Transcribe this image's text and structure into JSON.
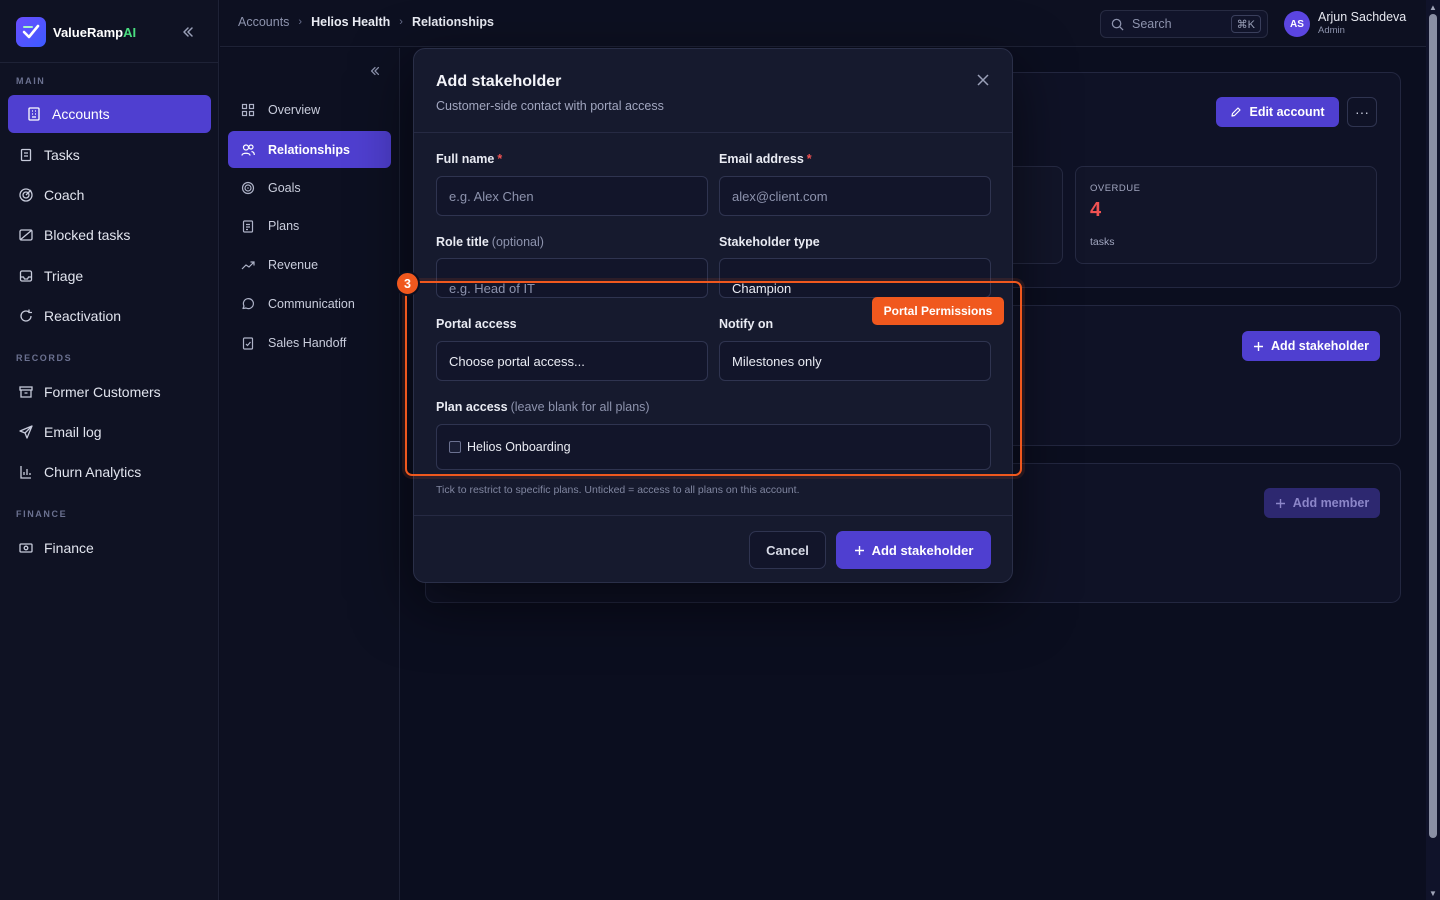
{
  "brand": {
    "name_main": "ValueRamp",
    "name_accent": "AI"
  },
  "sidebar": {
    "sections": {
      "main": "MAIN",
      "records": "RECORDS",
      "finance": "FINANCE"
    },
    "items": [
      {
        "label": "Accounts",
        "icon": "building-icon"
      },
      {
        "label": "Tasks",
        "icon": "clipboard-icon"
      },
      {
        "label": "Coach",
        "icon": "target-icon"
      },
      {
        "label": "Blocked tasks",
        "icon": "blocked-icon"
      },
      {
        "label": "Triage",
        "icon": "inbox-icon"
      },
      {
        "label": "Reactivation",
        "icon": "refresh-icon"
      },
      {
        "label": "Former Customers",
        "icon": "archive-icon"
      },
      {
        "label": "Email log",
        "icon": "send-icon"
      },
      {
        "label": "Churn Analytics",
        "icon": "chart-icon"
      },
      {
        "label": "Finance",
        "icon": "cash-icon"
      }
    ]
  },
  "topbar": {
    "breadcrumbs": [
      "Accounts",
      "Helios Health",
      "Relationships"
    ],
    "search_placeholder": "Search",
    "search_shortcut": "⌘K",
    "user": {
      "initials": "AS",
      "name": "Arjun Sachdeva",
      "role": "Admin"
    }
  },
  "subnav": {
    "items": [
      {
        "label": "Overview",
        "icon": "grid-icon"
      },
      {
        "label": "Relationships",
        "icon": "users-icon"
      },
      {
        "label": "Goals",
        "icon": "target-icon"
      },
      {
        "label": "Plans",
        "icon": "clipboard-icon"
      },
      {
        "label": "Revenue",
        "icon": "trend-icon"
      },
      {
        "label": "Communication",
        "icon": "chat-icon"
      },
      {
        "label": "Sales Handoff",
        "icon": "clipboard-check-icon"
      }
    ]
  },
  "background": {
    "edit_account": "Edit account",
    "overdue_label": "OVERDUE",
    "overdue_value": "4",
    "overdue_unit": "tasks",
    "add_stakeholder": "Add stakeholder",
    "add_member": "Add member"
  },
  "modal": {
    "title": "Add stakeholder",
    "subtitle": "Customer-side contact with portal access",
    "full_name_label": "Full name",
    "full_name_placeholder": "e.g. Alex Chen",
    "email_label": "Email address",
    "email_placeholder": "alex@client.com",
    "role_label": "Role title",
    "role_optional": "(optional)",
    "role_placeholder": "e.g. Head of IT",
    "type_label": "Stakeholder type",
    "type_value": "Champion",
    "portal_label": "Portal access",
    "portal_value": "Choose portal access...",
    "notify_label": "Notify on",
    "notify_value": "Milestones only",
    "plan_label": "Plan access",
    "plan_hint_inline": "(leave blank for all plans)",
    "plan_option": "Helios Onboarding",
    "plan_hint": "Tick to restrict to specific plans. Unticked = access to all plans on this account.",
    "required_mark": "*",
    "cancel": "Cancel",
    "submit": "Add stakeholder"
  },
  "annotation": {
    "step": "3",
    "tag": "Portal Permissions"
  },
  "colors": {
    "accent": "#4f3fd0",
    "highlight": "#f0581e",
    "danger": "#f05252",
    "brand_ai": "#4ade80"
  }
}
